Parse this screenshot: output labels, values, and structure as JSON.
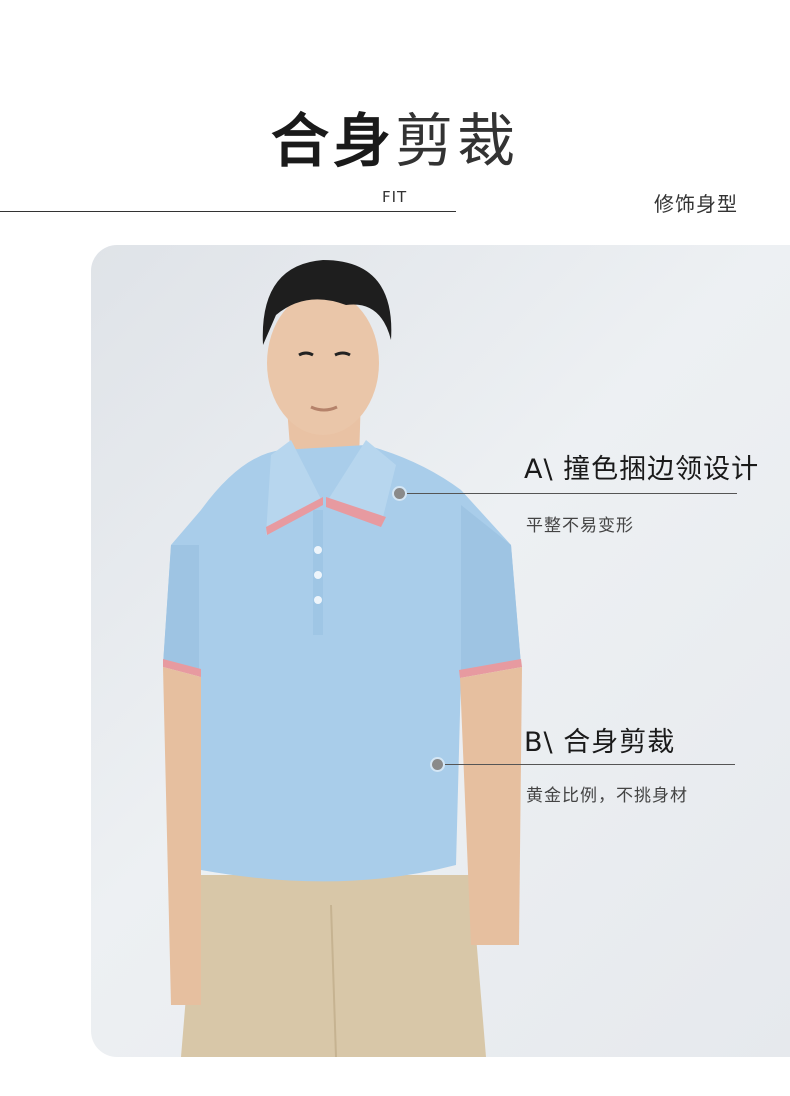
{
  "header": {
    "title_bold": "合身",
    "title_light": "剪裁",
    "subtitle_en": "FIT",
    "tagline": "修饰身型"
  },
  "callouts": [
    {
      "title": "A\\ 撞色捆边领设计",
      "desc": "平整不易变形"
    },
    {
      "title": "B\\ 合身剪裁",
      "desc": "黄金比例，不挑身材"
    }
  ],
  "colors": {
    "shirt": "#a9cdea",
    "collar_stripe": "#e79aa0",
    "pants": "#d8c7a8",
    "background": "#e6e9ed"
  }
}
